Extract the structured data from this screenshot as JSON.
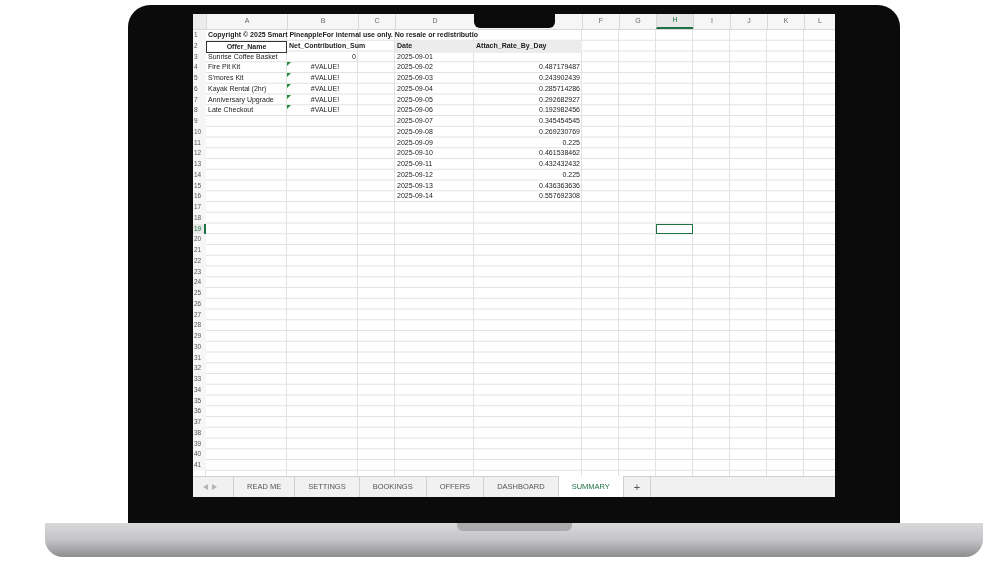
{
  "sheet": {
    "columns": [
      {
        "label": "A",
        "selected": false
      },
      {
        "label": "B",
        "selected": false
      },
      {
        "label": "C",
        "selected": false
      },
      {
        "label": "D",
        "selected": false
      },
      {
        "selected": false
      },
      {
        "label": "F",
        "selected": false
      },
      {
        "label": "G",
        "selected": false
      },
      {
        "label": "H",
        "selected": true
      },
      {
        "label": "I",
        "selected": false
      },
      {
        "label": "J",
        "selected": false
      },
      {
        "label": "K",
        "selected": false
      },
      {
        "label": "L",
        "selected": false
      }
    ],
    "rows": [
      {
        "number": "1",
        "selected": false,
        "cells": {
          "A": {
            "kind": "title",
            "text": "Copyright © 2025 Smart PineappleFor internal use only. No resale or redistributio"
          }
        }
      },
      {
        "number": "2",
        "selected": false,
        "cells": {
          "A": {
            "kind": "boxed_header",
            "text": "Offer_Name"
          },
          "B": {
            "kind": "header",
            "text": "Net_Contribution_Sum"
          },
          "D": {
            "kind": "shaded_header",
            "text": "Date"
          },
          "E": {
            "kind": "shaded_header",
            "text": "Attach_Rate_By_Day"
          }
        }
      },
      {
        "number": "3",
        "selected": false,
        "cells": {
          "A": {
            "kind": "text",
            "text": "Sunrise Coffee Basket"
          },
          "B": {
            "kind": "number",
            "text": "0"
          },
          "D": {
            "kind": "text",
            "text": "2025-09-01"
          }
        }
      },
      {
        "number": "4",
        "selected": false,
        "cells": {
          "A": {
            "kind": "text",
            "text": "Fire Pit Kit"
          },
          "B": {
            "kind": "error",
            "text": "#VALUE!",
            "flag": true
          },
          "D": {
            "kind": "text",
            "text": "2025-09-02"
          },
          "E": {
            "kind": "number",
            "text": "0.487179487"
          }
        }
      },
      {
        "number": "5",
        "selected": false,
        "cells": {
          "A": {
            "kind": "text",
            "text": "S'mores Kit"
          },
          "B": {
            "kind": "error",
            "text": "#VALUE!",
            "flag": true
          },
          "D": {
            "kind": "text",
            "text": "2025-09-03"
          },
          "E": {
            "kind": "number",
            "text": "0.243902439"
          }
        }
      },
      {
        "number": "6",
        "selected": false,
        "cells": {
          "A": {
            "kind": "text",
            "text": "Kayak Rental (2hr)"
          },
          "B": {
            "kind": "error",
            "text": "#VALUE!",
            "flag": true
          },
          "D": {
            "kind": "text",
            "text": "2025-09-04"
          },
          "E": {
            "kind": "number",
            "text": "0.285714286"
          }
        }
      },
      {
        "number": "7",
        "selected": false,
        "cells": {
          "A": {
            "kind": "text",
            "text": "Anniversary Upgrade"
          },
          "B": {
            "kind": "error",
            "text": "#VALUE!",
            "flag": true
          },
          "D": {
            "kind": "text",
            "text": "2025-09-05"
          },
          "E": {
            "kind": "number",
            "text": "0.292682927"
          }
        }
      },
      {
        "number": "8",
        "selected": false,
        "cells": {
          "A": {
            "kind": "text",
            "text": "Late Checkout"
          },
          "B": {
            "kind": "error",
            "text": "#VALUE!",
            "flag": true
          },
          "D": {
            "kind": "text",
            "text": "2025-09-06"
          },
          "E": {
            "kind": "number",
            "text": "0.192982456"
          }
        }
      },
      {
        "number": "9",
        "selected": false,
        "cells": {
          "D": {
            "kind": "text",
            "text": "2025-09-07"
          },
          "E": {
            "kind": "number",
            "text": "0.345454545"
          }
        }
      },
      {
        "number": "10",
        "selected": false,
        "cells": {
          "D": {
            "kind": "text",
            "text": "2025-09-08"
          },
          "E": {
            "kind": "number",
            "text": "0.269230769"
          }
        }
      },
      {
        "number": "11",
        "selected": false,
        "cells": {
          "D": {
            "kind": "text",
            "text": "2025-09-09"
          },
          "E": {
            "kind": "number",
            "text": "0.225"
          }
        }
      },
      {
        "number": "12",
        "selected": false,
        "cells": {
          "D": {
            "kind": "text",
            "text": "2025-09-10"
          },
          "E": {
            "kind": "number",
            "text": "0.461538462"
          }
        }
      },
      {
        "number": "13",
        "selected": false,
        "cells": {
          "D": {
            "kind": "text",
            "text": "2025-09-11"
          },
          "E": {
            "kind": "number",
            "text": "0.432432432"
          }
        }
      },
      {
        "number": "14",
        "selected": false,
        "cells": {
          "D": {
            "kind": "text",
            "text": "2025-09-12"
          },
          "E": {
            "kind": "number",
            "text": "0.225"
          }
        }
      },
      {
        "number": "15",
        "selected": false,
        "cells": {
          "D": {
            "kind": "text",
            "text": "2025-09-13"
          },
          "E": {
            "kind": "number",
            "text": "0.436363636"
          }
        }
      },
      {
        "number": "16",
        "selected": false,
        "cells": {
          "D": {
            "kind": "text",
            "text": "2025-09-14"
          },
          "E": {
            "kind": "number",
            "text": "0.557692308"
          }
        }
      },
      {
        "number": "17",
        "selected": false,
        "cells": {}
      },
      {
        "number": "18",
        "selected": false,
        "cells": {}
      },
      {
        "number": "19",
        "selected": true,
        "cells": {}
      },
      {
        "number": "20",
        "selected": false,
        "cells": {}
      },
      {
        "number": "21",
        "selected": false,
        "cells": {}
      },
      {
        "number": "22",
        "selected": false,
        "cells": {}
      },
      {
        "number": "23",
        "selected": false,
        "cells": {}
      },
      {
        "number": "24",
        "selected": false,
        "cells": {}
      },
      {
        "number": "25",
        "selected": false,
        "cells": {}
      },
      {
        "number": "26",
        "selected": false,
        "cells": {}
      },
      {
        "number": "27",
        "selected": false,
        "cells": {}
      },
      {
        "number": "28",
        "selected": false,
        "cells": {}
      },
      {
        "number": "29",
        "selected": false,
        "cells": {}
      },
      {
        "number": "30",
        "selected": false,
        "cells": {}
      },
      {
        "number": "31",
        "selected": false,
        "cells": {}
      },
      {
        "number": "32",
        "selected": false,
        "cells": {}
      },
      {
        "number": "33",
        "selected": false,
        "cells": {}
      },
      {
        "number": "34",
        "selected": false,
        "cells": {}
      },
      {
        "number": "35",
        "selected": false,
        "cells": {}
      },
      {
        "number": "36",
        "selected": false,
        "cells": {}
      },
      {
        "number": "37",
        "selected": false,
        "cells": {}
      },
      {
        "number": "38",
        "selected": false,
        "cells": {}
      },
      {
        "number": "39",
        "selected": false,
        "cells": {}
      },
      {
        "number": "40",
        "selected": false,
        "cells": {}
      },
      {
        "number": "41",
        "selected": false,
        "cells": {}
      }
    ]
  },
  "sheet_tabs": {
    "tabs": [
      {
        "label": "READ ME",
        "selected": false
      },
      {
        "label": "SETTINGS",
        "selected": false
      },
      {
        "label": "BOOKINGS",
        "selected": false
      },
      {
        "label": "OFFERS",
        "selected": false
      },
      {
        "label": "DASHBOARD",
        "selected": false
      },
      {
        "label": "SUMMARY",
        "selected": true
      }
    ],
    "add_button": "+"
  }
}
